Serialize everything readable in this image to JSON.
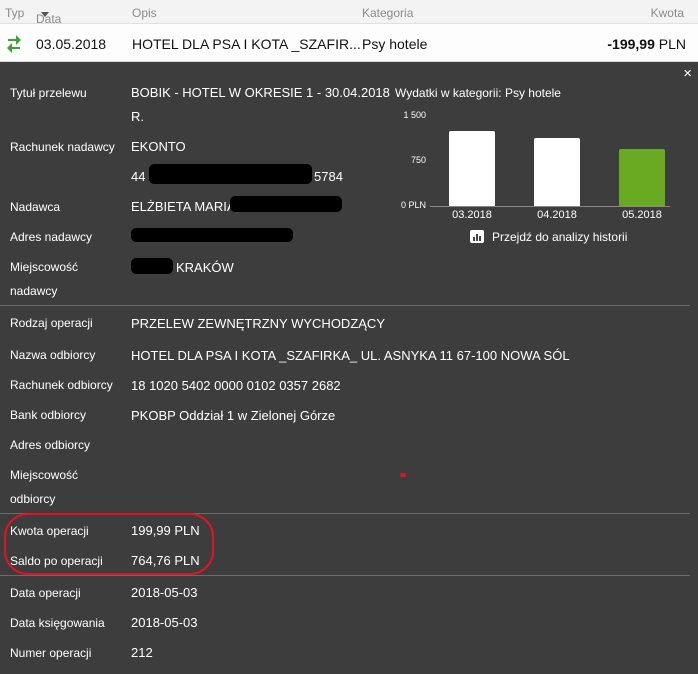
{
  "header": {
    "typ": "Typ",
    "data": "Data",
    "opis": "Opis",
    "kategoria": "Kategoria",
    "kwota": "Kwota"
  },
  "transaction": {
    "type_icon": "transfer-arrows-icon",
    "date": "03.05.2018",
    "description": "HOTEL DLA PSA I KOTA _SZAFIR...",
    "category": "Psy hotele",
    "amount": "-199,99",
    "currency": "PLN"
  },
  "details": {
    "close": "×",
    "tytul_label": "Tytuł przelewu",
    "tytul_line1": "BOBIK - HOTEL W OKRESIE 1 - 30.04.2018",
    "tytul_line2": "R.",
    "rach_nad_label": "Rachunek nadawcy",
    "rach_nad_name": "EKONTO",
    "rach_nad_prefix": "44",
    "rach_nad_suffix": "5784",
    "nadawca_label": "Nadawca",
    "nadawca_value": "ELŻBIETA MARIA",
    "adres_nad_label": "Adres nadawcy",
    "miejsc_nad_label1": "Miejscowość",
    "miejsc_nad_label2": "nadawcy",
    "miejsc_nad_value": "KRAKÓW",
    "rodzaj_label": "Rodzaj operacji",
    "rodzaj_value": "PRZELEW ZEWNĘTRZNY WYCHODZĄCY",
    "nazwa_odb_label": "Nazwa odbiorcy",
    "nazwa_odb_value": "HOTEL DLA PSA I KOTA _SZAFIRKA_ UL. ASNYKA 11 67-100 NOWA SÓL",
    "rach_odb_label": "Rachunek odbiorcy",
    "rach_odb_value": "18 1020 5402 0000 0102 0357 2682",
    "bank_label": "Bank odbiorcy",
    "bank_value": "PKOBP Oddział 1 w Zielonej Górze",
    "adres_odb_label": "Adres odbiorcy",
    "miejsc_odb_label1": "Miejscowość",
    "miejsc_odb_label2": "odbiorcy",
    "kwota_label": "Kwota operacji",
    "kwota_value": "199,99 PLN",
    "saldo_label": "Saldo po operacji",
    "saldo_value": "764,76 PLN",
    "data_op_label": "Data operacji",
    "data_op_value": "2018-05-03",
    "data_ks_label": "Data księgowania",
    "data_ks_value": "2018-05-03",
    "numer_label": "Numer operacji",
    "numer_value": "212"
  },
  "chart_data": {
    "type": "bar",
    "title": "Wydatki w kategorii:",
    "category_name": "Psy hotele",
    "categories": [
      "03.2018",
      "04.2018",
      "05.2018"
    ],
    "values": [
      1250,
      1140,
      950
    ],
    "ylim": [
      0,
      1500
    ],
    "ytick_values": [
      0,
      750,
      1500
    ],
    "ytick_labels": [
      "0 PLN",
      "750",
      "1 500"
    ],
    "colors": [
      "#ffffff",
      "#ffffff",
      "#6aaa22"
    ],
    "history_link": "Przejdź do analizy historii"
  }
}
